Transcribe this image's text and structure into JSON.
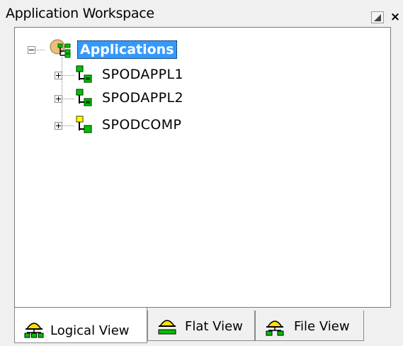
{
  "window": {
    "title": "Application Workspace",
    "minimize_glyph": "",
    "close_glyph": "×"
  },
  "tree": {
    "root": {
      "label": "Applications",
      "expanded": true,
      "selected": true,
      "icon": "applications-folder-icon"
    },
    "children": [
      {
        "label": "SPODAPPL1",
        "expanded": false,
        "icon": "application-icon",
        "icon_color": "#00c000"
      },
      {
        "label": "SPODAPPL2",
        "expanded": false,
        "icon": "application-icon",
        "icon_color": "#00c000"
      },
      {
        "label": "SPODCOMP",
        "expanded": false,
        "icon": "component-icon",
        "icon_color": "#ffff00"
      }
    ]
  },
  "tabs": [
    {
      "label": "Logical View",
      "active": true,
      "icon": "logical-view-icon"
    },
    {
      "label": "Flat View",
      "active": false,
      "icon": "flat-view-icon"
    },
    {
      "label": "File View",
      "active": false,
      "icon": "file-view-icon"
    }
  ],
  "colors": {
    "selection": "#3399ff",
    "node_green": "#00c000",
    "node_yellow": "#ffff00",
    "tab_icon_yellow": "#ffe000"
  }
}
